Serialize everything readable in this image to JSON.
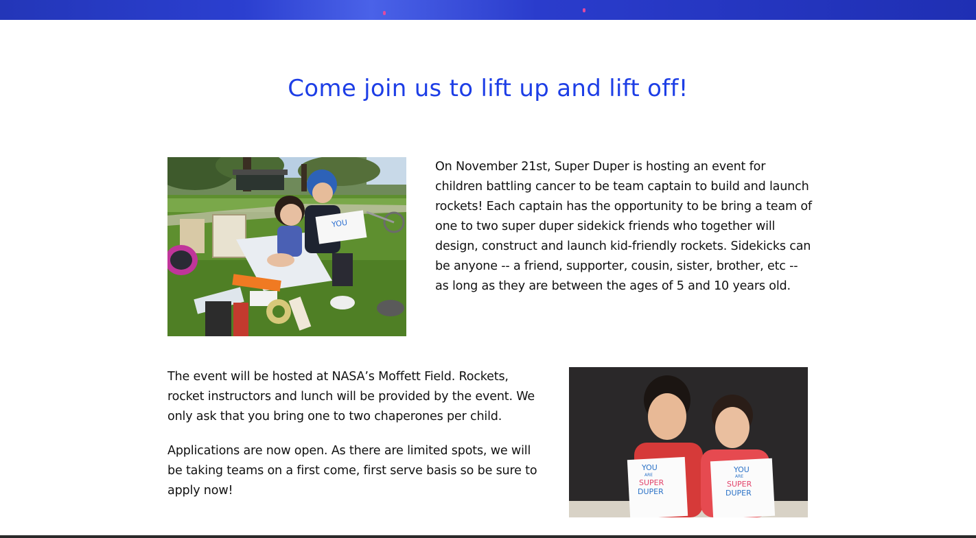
{
  "headline": "Come join us to lift up and lift off!",
  "paragraphs": {
    "event_intro": "On November 21st, Super Duper is hosting an event for children battling cancer to be team captain to build and launch rockets! Each captain has the opportunity to be bring a team of one to two super duper sidekick friends who together will design, construct and launch kid-friendly rockets. Sidekicks can be anyone -- a friend, supporter, cousin, sister, brother, etc -- as long as they are between the ages of 5 and 10 years old.",
    "venue": "The event will be hosted at NASA’s Moffett Field. Rockets, rocket instructors and lunch will be provided by the event. We only ask that you bring one to two chaperones per child.",
    "applications": "Applications are now open. As there are limited spots, we will be taking teams on a first come, first serve basis so be sure to apply now!"
  },
  "photos": {
    "picnic": {
      "sign_text": "YOU"
    },
    "kids": {
      "sign_lines": [
        "YOU",
        "ARE",
        "SUPER",
        "DUPER"
      ]
    }
  },
  "colors": {
    "headline": "#1d3ee6",
    "banner": "#2336b8",
    "body_text": "#111111"
  }
}
